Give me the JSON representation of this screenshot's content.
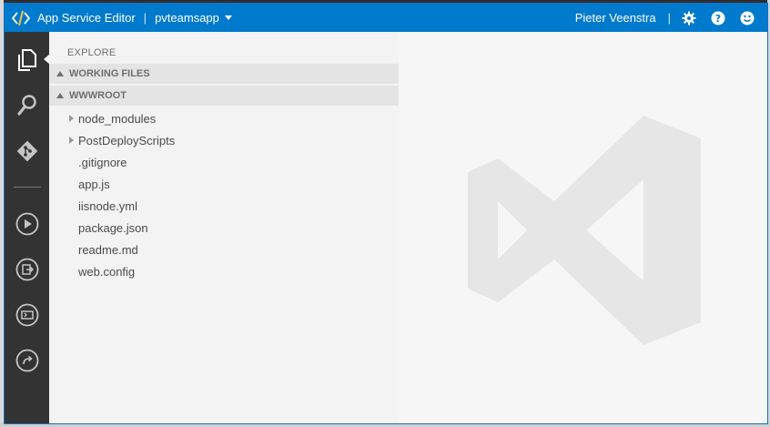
{
  "topbar": {
    "app_title": "App Service Editor",
    "site_name": "pvteamsapp",
    "user_name": "Pieter Veenstra",
    "separator": "|",
    "icons": [
      "settings-gear-icon",
      "help-icon",
      "feedback-smiley-icon"
    ]
  },
  "activity_bar": {
    "items": [
      "explorer-icon",
      "search-icon",
      "git-icon",
      "run-icon",
      "output-icon",
      "console-icon",
      "history-icon"
    ]
  },
  "explorer": {
    "title": "EXPLORE",
    "working_files_label": "WORKING FILES",
    "wwwroot_label": "WWWROOT",
    "folders": [
      "node_modules",
      "PostDeployScripts"
    ],
    "files": [
      ".gitignore",
      "app.js",
      "iisnode.yml",
      "package.json",
      "readme.md",
      "web.config"
    ]
  },
  "colors": {
    "accent": "#007acc",
    "activity_bar": "#333333",
    "sidebar": "#f3f3f3",
    "editor": "#f6f6f6"
  }
}
